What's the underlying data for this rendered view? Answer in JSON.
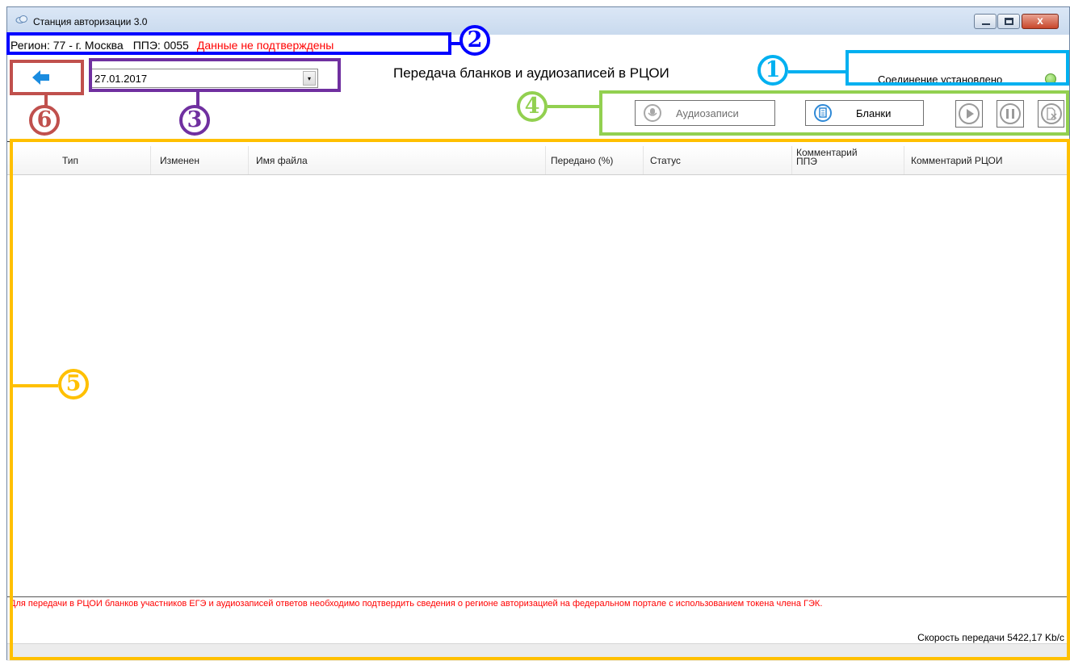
{
  "window": {
    "title": "Станция авторизации 3.0",
    "icons": {
      "app": "cloud-app-icon",
      "minimize": "minimize-icon",
      "maximize": "maximize-icon",
      "close": "close-icon",
      "close_glyph": "x"
    }
  },
  "header": {
    "region": "Регион: 77 - г. Москва",
    "ppe": "ППЭ: 0055",
    "warning": "Данные не подтверждены",
    "page_title": "Передача бланков и аудиозаписей в РЦОИ",
    "back_icon": "arrow-left-icon",
    "date_value": "27.01.2017",
    "date_arrow": "▾"
  },
  "connection": {
    "status": "Соединение установлено",
    "led_color": "#6fc53e"
  },
  "toolbar": {
    "audio_label": "Аудиозаписи",
    "blanks_label": "Бланки",
    "audio_icon": "microphone-icon",
    "blanks_icon": "document-icon",
    "play_icon": "play-icon",
    "pause_icon": "pause-icon",
    "cancel_icon": "cancel-file-icon"
  },
  "table": {
    "columns": [
      "Тип",
      "Изменен",
      "Имя файла",
      "Передано (%)",
      "Статус",
      "Комментарий ППЭ",
      "Комментарий РЦОИ"
    ],
    "rows": []
  },
  "footer": {
    "message": "Для передачи в РЦОИ бланков участников ЕГЭ и аудиозаписей ответов необходимо подтвердить сведения о регионе авторизацией на федеральном портале с использованием токена члена ГЭК.",
    "speed": "Скорость передачи 5422,17 Kb/c"
  },
  "annotations": {
    "labels": [
      "1",
      "2",
      "3",
      "4",
      "5",
      "6"
    ],
    "colors": {
      "1": "#00b0f0",
      "2": "#0000ff",
      "3": "#7030a0",
      "4": "#92d050",
      "5": "#ffc000",
      "6": "#c0504d"
    }
  }
}
